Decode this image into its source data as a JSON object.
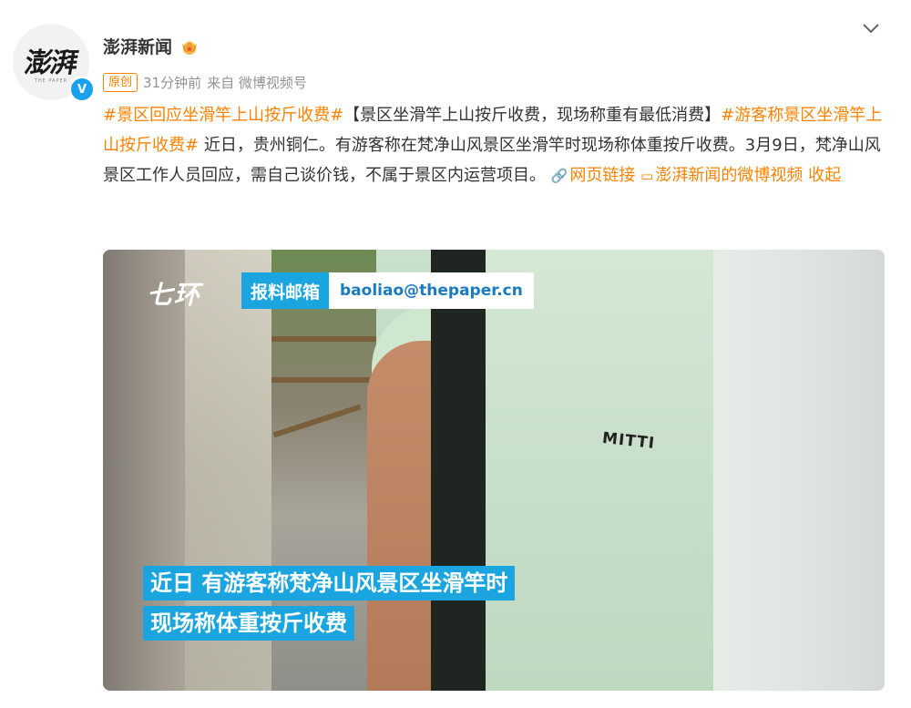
{
  "author": {
    "name": "澎湃新闻",
    "avatar_text": "澎湃",
    "avatar_sub": "THE PAPER",
    "verified_mark": "V"
  },
  "meta": {
    "badge": "原创",
    "time": "31分钟前",
    "source": "来自 微博视频号"
  },
  "post": {
    "tag1": "#景区回应坐滑竿上山按斤收费#",
    "headline": "【景区坐滑竿上山按斤收费，现场称重有最低消费】",
    "tag2": "#游客称景区坐滑竿上山按斤收费#",
    "body": " 近日，贵州铜仁。有游客称在梵净山风景区坐滑竿时现场称体重按斤收费。3月9日，梵净山风景区工作人员回应，需自己谈价钱，不属于景区内运营项目。",
    "link_label": "网页链接",
    "video_link_label": "澎湃新闻的微博视频",
    "collapse_label": "收起"
  },
  "video": {
    "brand": "七环",
    "tip_label": "报料邮箱",
    "tip_email": "baoliao@thepaper.cn",
    "shirt_text": "MITTI",
    "caption_line1": "近日 有游客称梵净山风景区坐滑竿时",
    "caption_line2": "现场称体重按斤收费"
  },
  "colors": {
    "accent": "#ff8200",
    "caption_bg": "#1aa5e0",
    "verified": "#1aa0f0"
  }
}
